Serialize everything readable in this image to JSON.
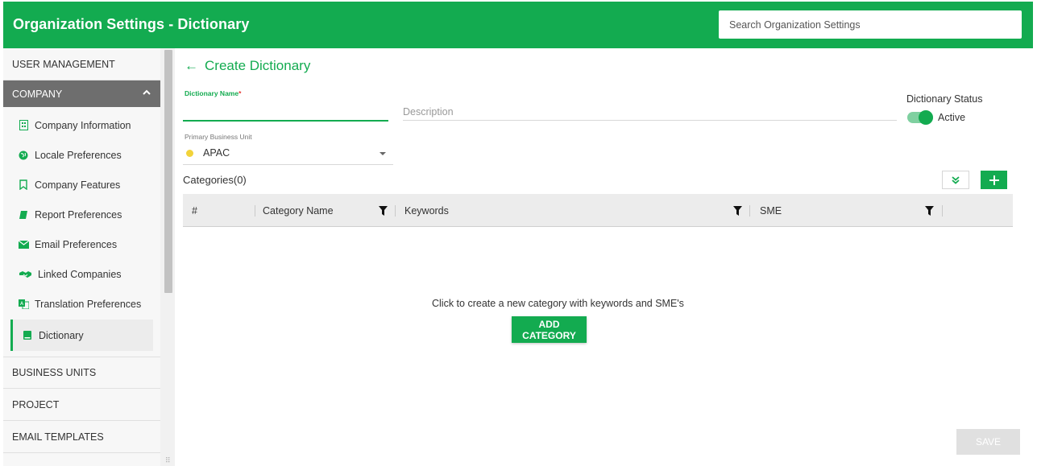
{
  "header": {
    "title": "Organization Settings - Dictionary",
    "search_placeholder": "Search Organization Settings"
  },
  "sidebar": {
    "user_management": "USER MANAGEMENT",
    "company": "COMPANY",
    "company_items": [
      {
        "label": "Company Information",
        "icon": "building-icon"
      },
      {
        "label": "Locale Preferences",
        "icon": "globe-icon"
      },
      {
        "label": "Company Features",
        "icon": "bookmark-icon"
      },
      {
        "label": "Report Preferences",
        "icon": "book-icon"
      },
      {
        "label": "Email Preferences",
        "icon": "envelope-icon"
      },
      {
        "label": "Linked Companies",
        "icon": "handshake-icon"
      },
      {
        "label": "Translation Preferences",
        "icon": "translate-icon"
      },
      {
        "label": "Dictionary",
        "icon": "dictionary-icon",
        "active": true
      }
    ],
    "business_units": "BUSINESS UNITS",
    "project": "PROJECT",
    "email_templates": "EMAIL TEMPLATES"
  },
  "main": {
    "back_title": "Create Dictionary",
    "dictionary_name_label": "Dictionary Name",
    "required_mark": "*",
    "dictionary_name_value": "",
    "description_placeholder": "Description",
    "status_label": "Dictionary Status",
    "status_value": "Active",
    "status_on": true,
    "primary_bu_label": "Primary Business Unit",
    "primary_bu_value": "APAC",
    "primary_bu_dot_color": "#f2d33a",
    "categories_title": "Categories(0)",
    "table_headers": [
      "#",
      "Category Name",
      "Keywords",
      "SME"
    ],
    "empty_message": "Click to create a new category with keywords and SME's",
    "add_category_label": "ADD CATEGORY",
    "save_label": "SAVE"
  },
  "colors": {
    "brand_green": "#13ab50",
    "sidebar_active_bg": "#6e6e6e",
    "save_disabled": "#e0e0e0"
  }
}
